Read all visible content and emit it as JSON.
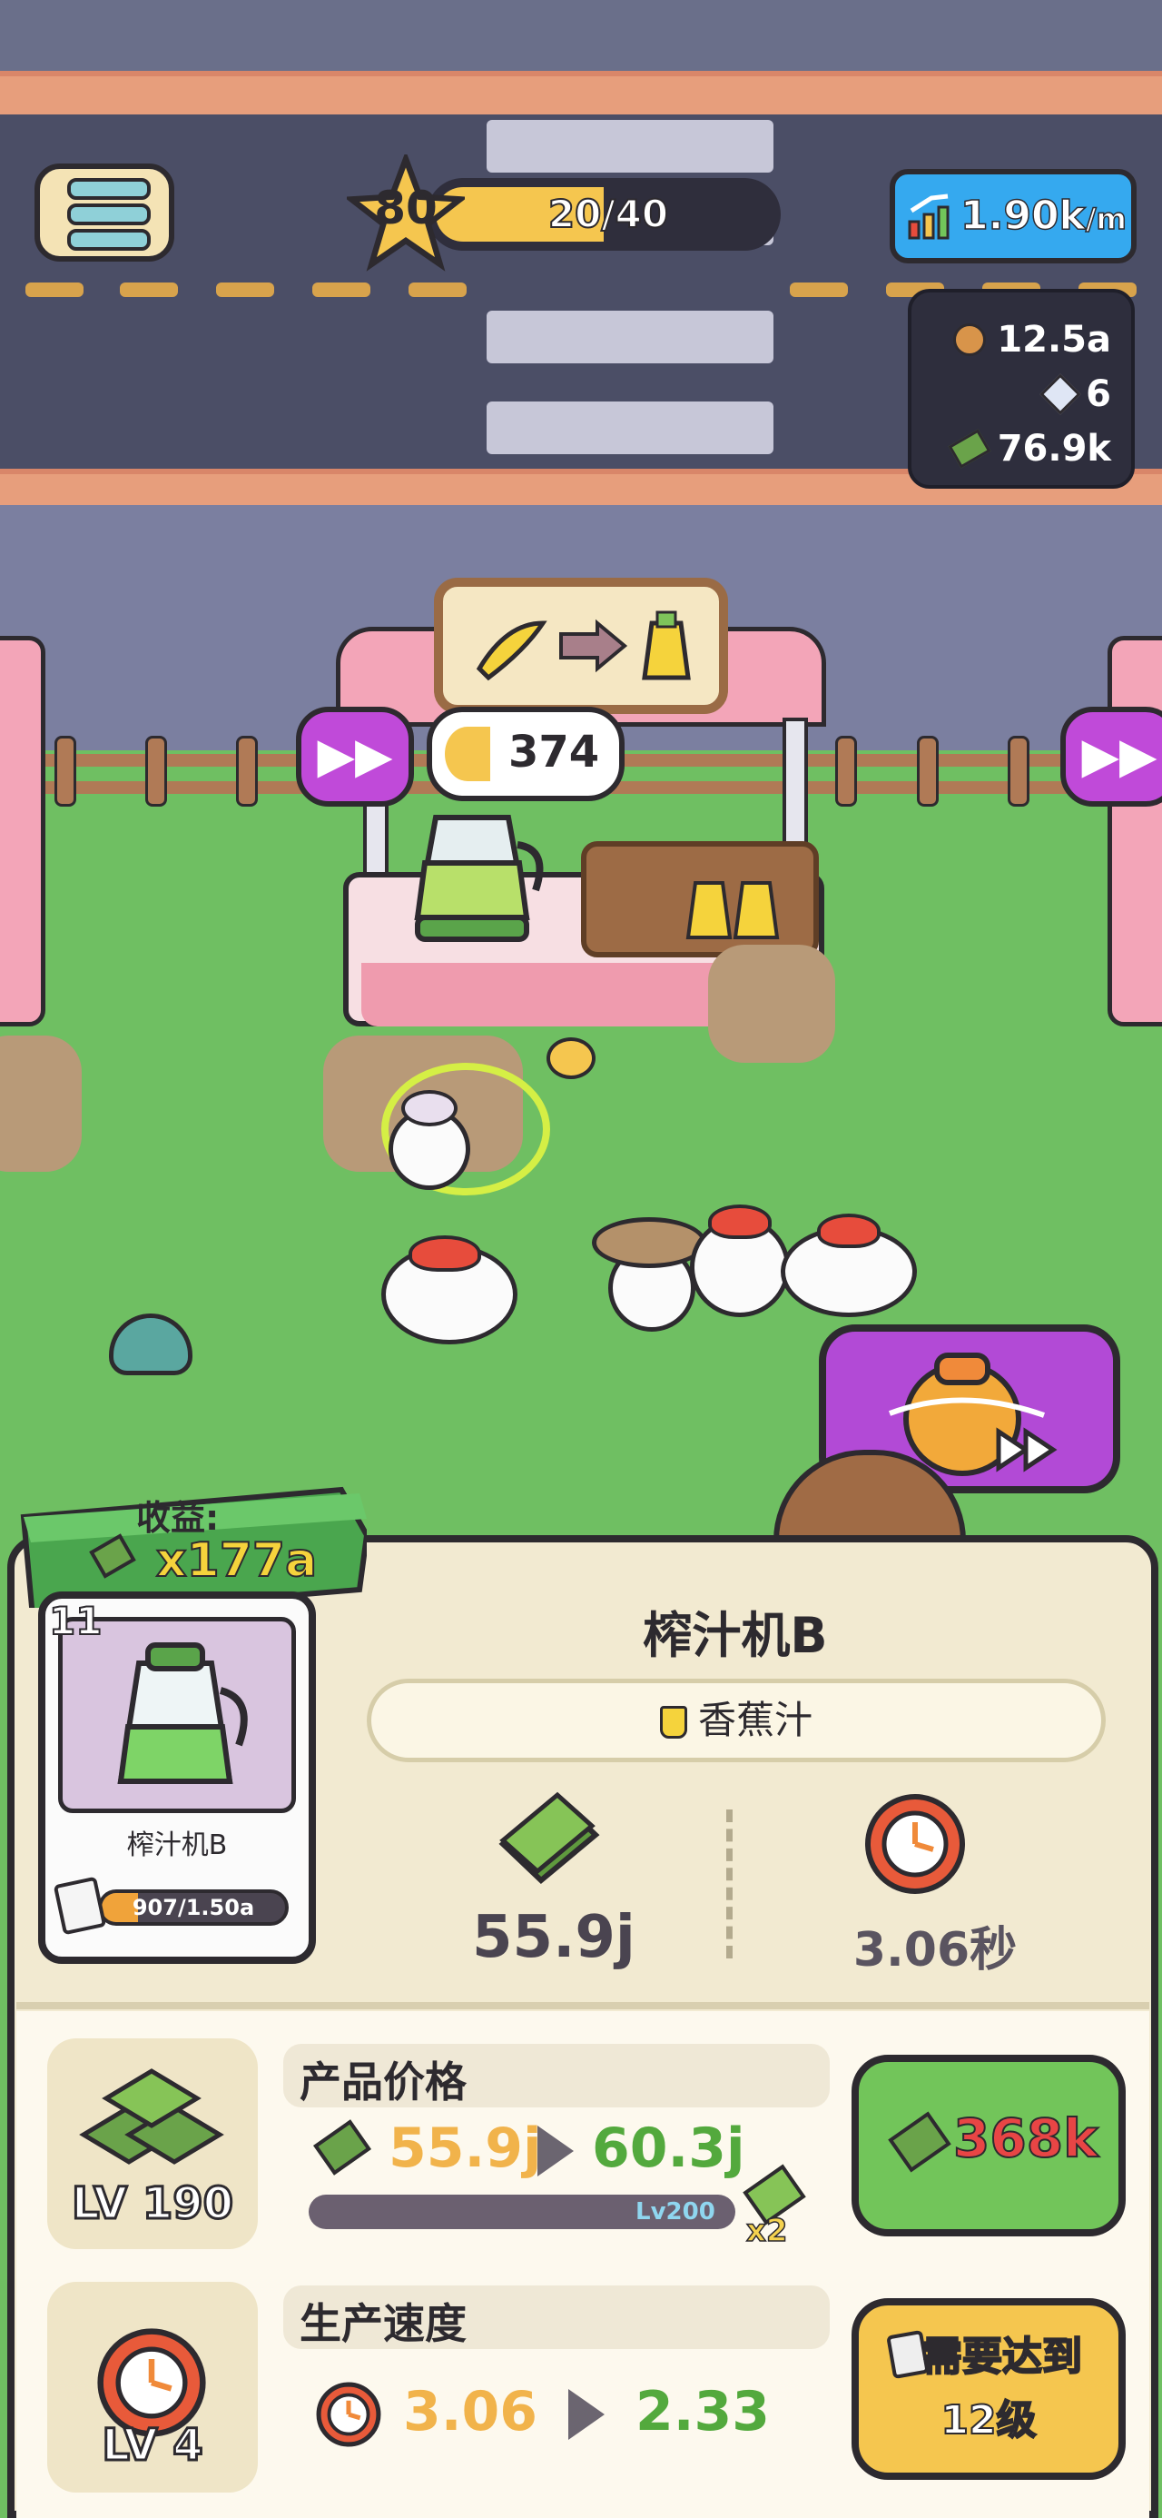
{
  "hud": {
    "player_level": "80",
    "xp_progress": "20/40",
    "xp_fraction": 0.5,
    "income_rate": "1.90k",
    "income_rate_unit": "/m",
    "resources": [
      {
        "icon": "cookie-icon",
        "value": "12.5a"
      },
      {
        "icon": "gem-icon",
        "value": "6"
      },
      {
        "icon": "cash-icon",
        "value": "76.9k"
      }
    ]
  },
  "stall": {
    "stock_count": "374",
    "fast_forward_label": "▶▶"
  },
  "panel": {
    "banner_title": "收益:",
    "banner_value": "x177a",
    "card_level": "11",
    "card_name": "榨汁机B",
    "card_progress": "907/1.50a",
    "card_progress_fraction": 0.2,
    "machine_name": "榨汁机B",
    "product_name": "香蕉汁",
    "price": "55.9j",
    "time": "3.06秒"
  },
  "upgrades": {
    "price": {
      "label": "产品价格",
      "level": "LV 190",
      "from": "55.9j",
      "to": "60.3j",
      "milestone": "Lv200",
      "milestone_fraction": 0.95,
      "multiplier": "x2",
      "cost": "368k"
    },
    "speed": {
      "label": "生产速度",
      "level": "LV 4",
      "from": "3.06",
      "to": "2.33",
      "locked_line1": "需要达到",
      "locked_line2": "12级"
    }
  },
  "colors": {
    "grass": "#6fbf62",
    "road": "#4b4e66",
    "accent_green": "#53a93d",
    "accent_orange": "#f1b34b",
    "purple": "#c04ad9"
  }
}
